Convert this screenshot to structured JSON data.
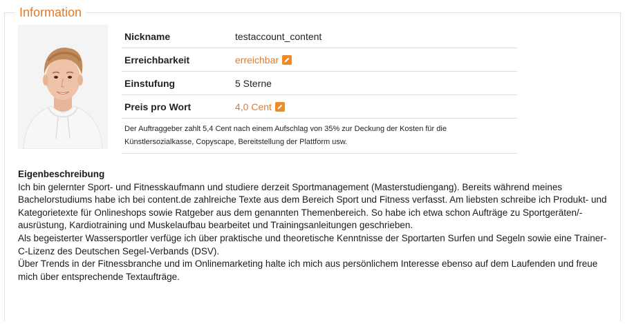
{
  "section": {
    "title": "Information"
  },
  "profile": {
    "rows": [
      {
        "label": "Nickname",
        "value": "testaccount_content"
      },
      {
        "label": "Erreichbarkeit",
        "value": "erreichbar"
      },
      {
        "label": "Einstufung",
        "value": "5 Sterne"
      },
      {
        "label": "Preis pro Wort",
        "value": "4,0 Cent"
      }
    ],
    "note": "Der Auftraggeber zahlt 5,4 Cent nach einem Aufschlag von 35% zur Deckung der Kosten für die Künstlersozialkasse, Copyscape, Bereitstellung der Plattform usw."
  },
  "description": {
    "heading": "Eigenbeschreibung",
    "paragraphs": [
      "Ich bin gelernter Sport- und Fitnesskaufmann und studiere derzeit Sportmanagement (Masterstudiengang). Bereits während meines Bachelorstudiums habe ich bei content.de zahlreiche Texte aus dem Bereich Sport und Fitness verfasst. Am liebsten schreibe ich Produkt- und Kategorietexte für Onlineshops sowie Ratgeber aus dem genannten Themenbereich. So habe ich etwa schon Aufträge zu Sportgeräten/-ausrüstung, Kardiotraining und Muskelaufbau bearbeitet und Trainingsanleitungen geschrieben.",
      "Als begeisterter Wassersportler verfüge ich über praktische und theoretische Kenntnisse der Sportarten Surfen und Segeln sowie eine Trainer-C-Lizenz des Deutschen Segel-Verbands (DSV).",
      "Über Trends in der Fitnessbranche und im Onlinemarketing halte ich mich aus persönlichem Interesse ebenso auf dem Laufenden und freue mich über entsprechende Textaufträge."
    ]
  },
  "colors": {
    "accent": "#e2792b",
    "edit_icon": "#f08a24",
    "divider": "#dcdcdc"
  },
  "icons": {
    "edit": "pencil-icon"
  }
}
